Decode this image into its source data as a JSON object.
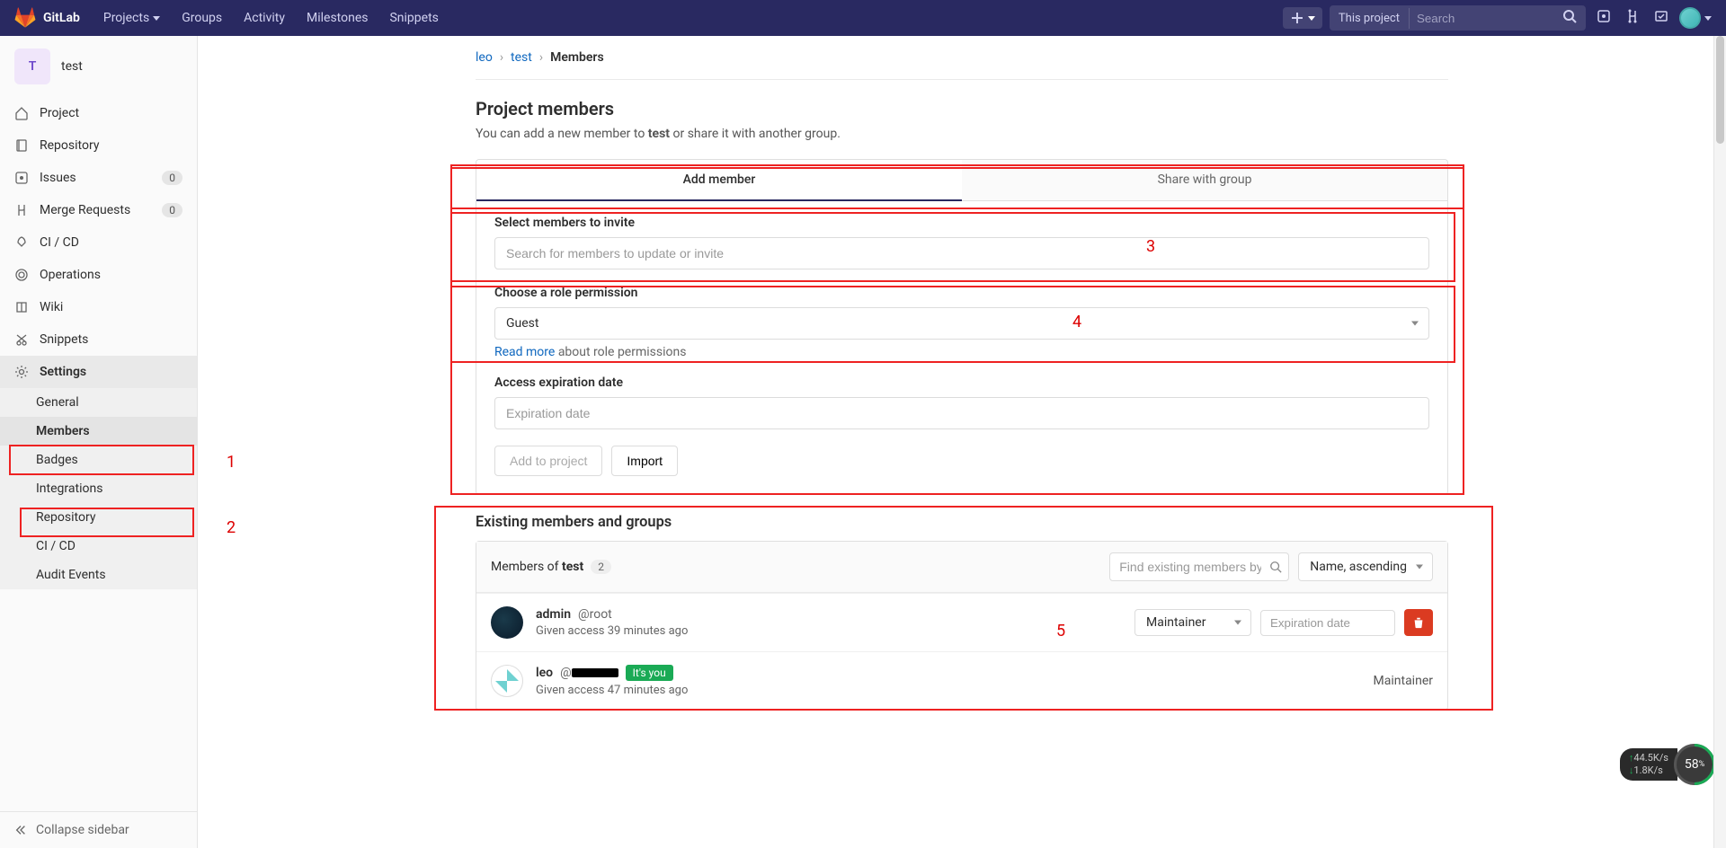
{
  "navbar": {
    "brand": "GitLab",
    "links": {
      "projects": "Projects",
      "groups": "Groups",
      "activity": "Activity",
      "milestones": "Milestones",
      "snippets": "Snippets"
    },
    "search_scope": "This project",
    "search_placeholder": "Search"
  },
  "sidebar": {
    "project_initial": "T",
    "project_name": "test",
    "items": {
      "project": "Project",
      "repository": "Repository",
      "issues": "Issues",
      "issues_count": "0",
      "merge_requests": "Merge Requests",
      "mr_count": "0",
      "cicd": "CI / CD",
      "operations": "Operations",
      "wiki": "Wiki",
      "snippets": "Snippets",
      "settings": "Settings"
    },
    "settings_sub": {
      "general": "General",
      "members": "Members",
      "badges": "Badges",
      "integrations": "Integrations",
      "repository": "Repository",
      "cicd": "CI / CD",
      "audit": "Audit Events"
    },
    "collapse": "Collapse sidebar"
  },
  "breadcrumb": {
    "a": "leo",
    "b": "test",
    "c": "Members"
  },
  "page": {
    "title": "Project members",
    "subtitle_pre": "You can add a new member to ",
    "subtitle_proj": "test",
    "subtitle_post": " or share it with another group."
  },
  "tabs": {
    "add": "Add member",
    "share": "Share with group"
  },
  "form": {
    "select_label": "Select members to invite",
    "select_placeholder": "Search for members to update or invite",
    "role_label": "Choose a role permission",
    "role_value": "Guest",
    "readmore": "Read more",
    "readmore_tail": " about role permissions",
    "exp_label": "Access expiration date",
    "exp_placeholder": "Expiration date",
    "add_btn": "Add to project",
    "import_btn": "Import"
  },
  "existing": {
    "heading": "Existing members and groups",
    "members_of_pre": "Members of ",
    "members_of_proj": "test",
    "count": "2",
    "find_placeholder": "Find existing members by name",
    "sort": "Name, ascending"
  },
  "members": [
    {
      "name": "admin",
      "handle": "@root",
      "access": "Given access 39 minutes ago",
      "role": "Maintainer",
      "exp_placeholder": "Expiration date",
      "editable": true,
      "you": false
    },
    {
      "name": "leo",
      "handle_prefix": "@",
      "access": "Given access 47 minutes ago",
      "role": "Maintainer",
      "editable": false,
      "you": true,
      "you_label": "It's you"
    }
  ],
  "annotations": {
    "1": "1",
    "2": "2",
    "3": "3",
    "4": "4",
    "5": "5"
  },
  "net": {
    "up": "44.5K/s",
    "dn": "1.8K/s",
    "pct": "58",
    "pct_suffix": "%"
  }
}
